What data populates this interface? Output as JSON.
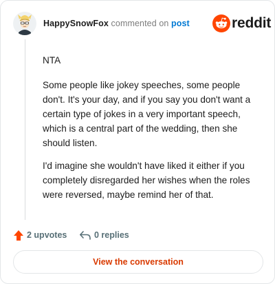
{
  "comment": {
    "author": "HappySnowFox",
    "action_text": "commented on",
    "target_link": "post",
    "paragraphs": [
      "NTA",
      "Some people like jokey speeches, some people don't. It's your day, and if you say you don't want a certain type of jokes in a very important speech, which is a central part of the wedding, then she should listen.",
      "I'd imagine she wouldn't have liked it either if you completely disregarded her wishes when the roles were reversed, maybe remind her of that."
    ]
  },
  "brand": {
    "logo_text": "reddit",
    "logo_icon": "reddit-snoo-icon",
    "accent_color": "#ff4500"
  },
  "actions": {
    "upvotes_label": "2 upvotes",
    "upvote_icon": "upvote-arrow-icon",
    "upvote_color": "#ff4500",
    "replies_label": "0 replies",
    "reply_icon": "reply-arrow-icon"
  },
  "footer": {
    "view_button_label": "View the conversation",
    "view_button_color": "#d93a00"
  }
}
